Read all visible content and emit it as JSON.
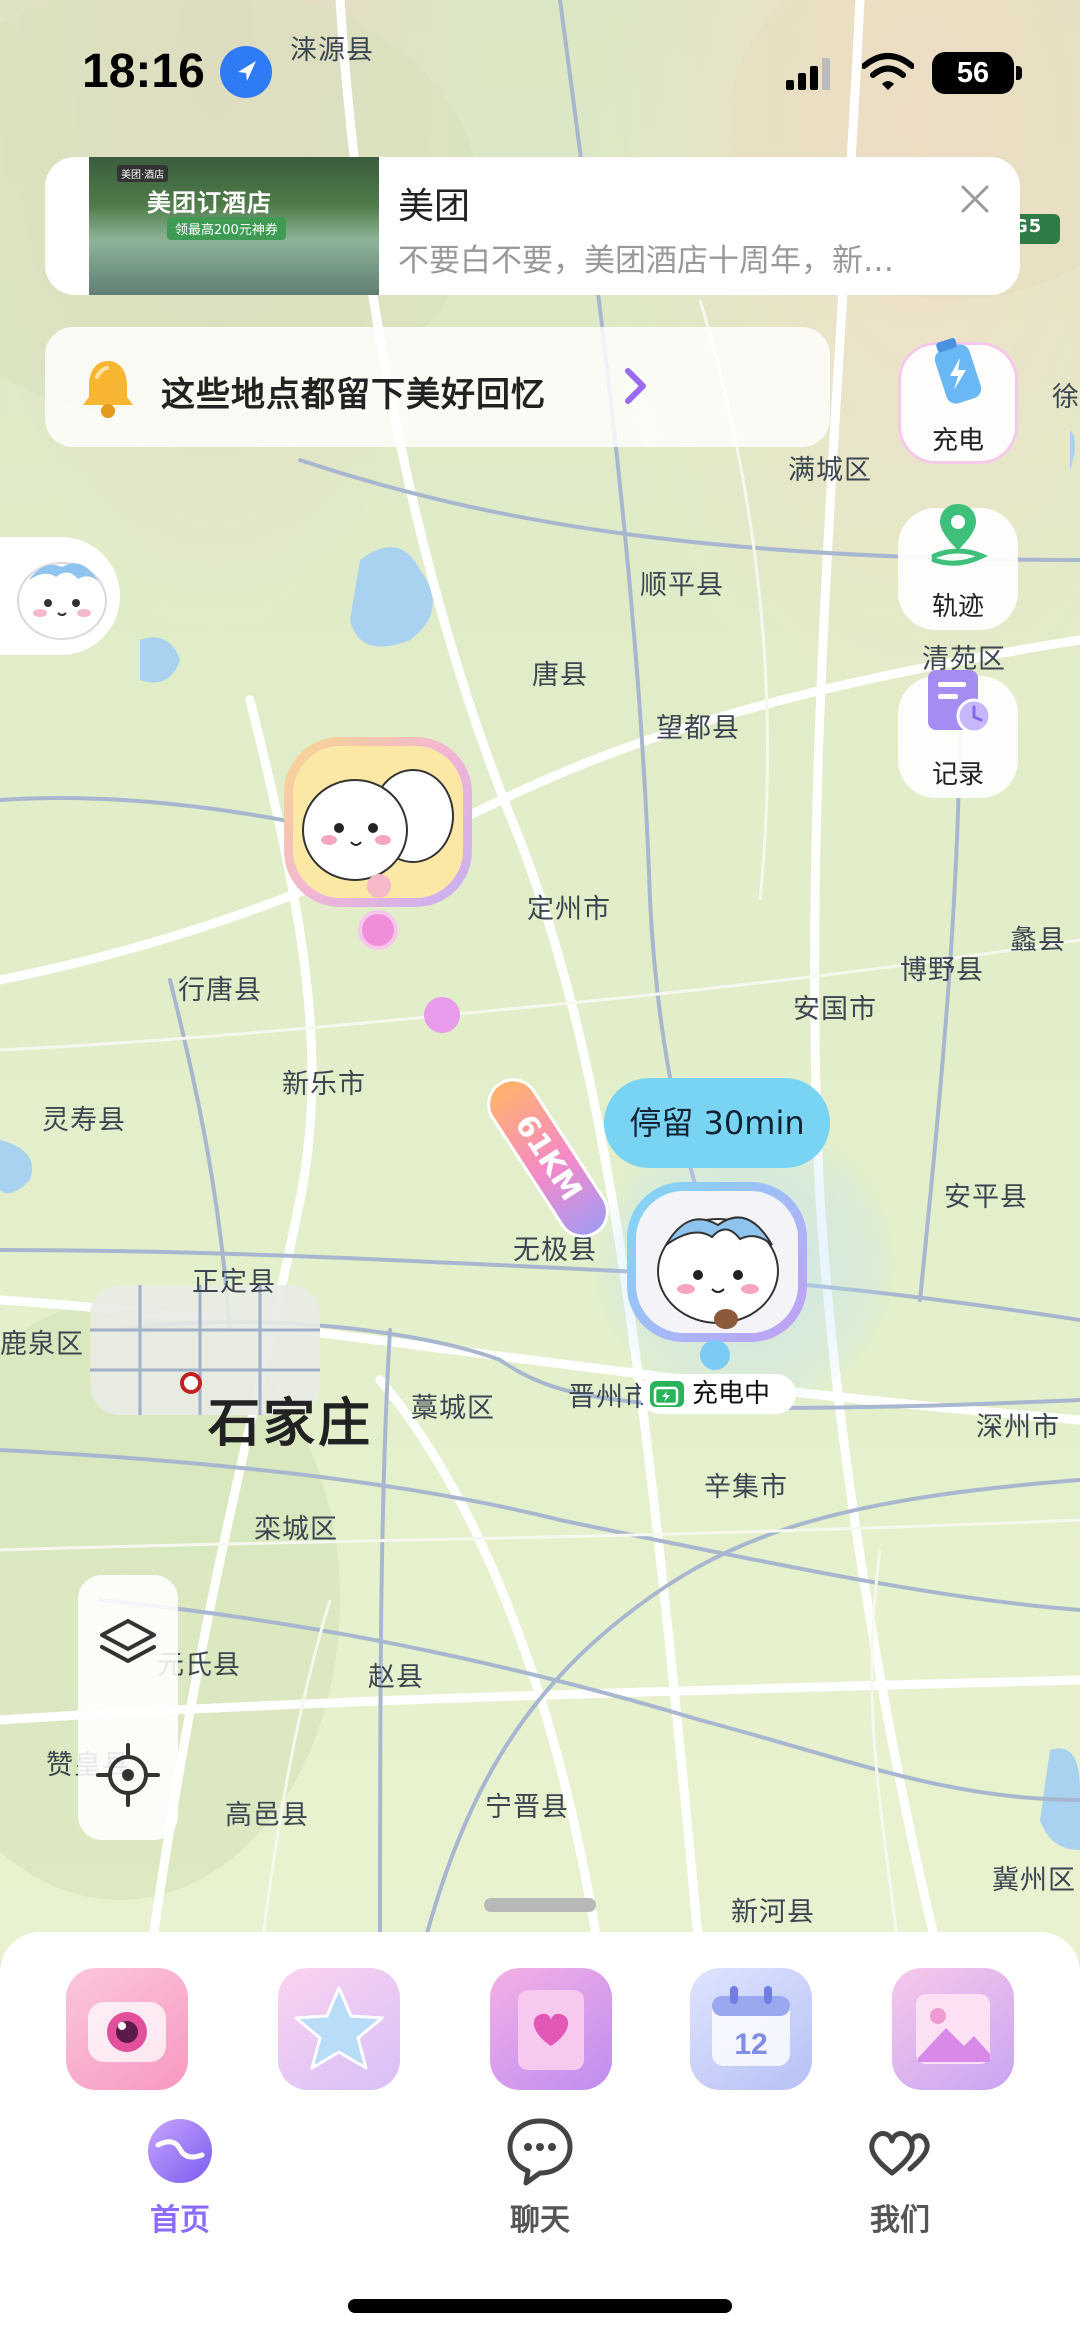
{
  "status_bar": {
    "time": "18:16",
    "battery": "56"
  },
  "ad": {
    "thumb_tag": "美团·酒店",
    "thumb_title": "美团订酒店",
    "thumb_sub": "领最高200元神券",
    "title": "美团",
    "description": "不要白不要，美团酒店十周年，新…"
  },
  "memory_banner": {
    "text": "这些地点都留下美好回忆"
  },
  "side_actions": {
    "charge": "充电",
    "track": "轨迹",
    "record": "记录"
  },
  "map": {
    "places": [
      "涞源县",
      "满城区",
      "顺平县",
      "唐县",
      "清苑区",
      "望都县",
      "定州市",
      "博野县",
      "蠡县",
      "行唐县",
      "安国市",
      "新乐市",
      "灵寿县",
      "无极县",
      "安平县",
      "正定县",
      "鹿泉区",
      "石家庄",
      "藁城区",
      "晋州市",
      "深州市",
      "辛集市",
      "栾城区",
      "元氏县",
      "赵县",
      "赞皇县",
      "宁晋县",
      "高邑县",
      "新河县",
      "冀州区",
      "徐",
      "G5"
    ],
    "distance": "61KM",
    "stay": "停留 30min",
    "charging": "充电中"
  },
  "tabs": {
    "home": "首页",
    "chat": "聊天",
    "us": "我们"
  },
  "colors": {
    "accent": "#8c6bff",
    "stay_bubble": "#79d4f3",
    "charging_green": "#2ab45a"
  }
}
